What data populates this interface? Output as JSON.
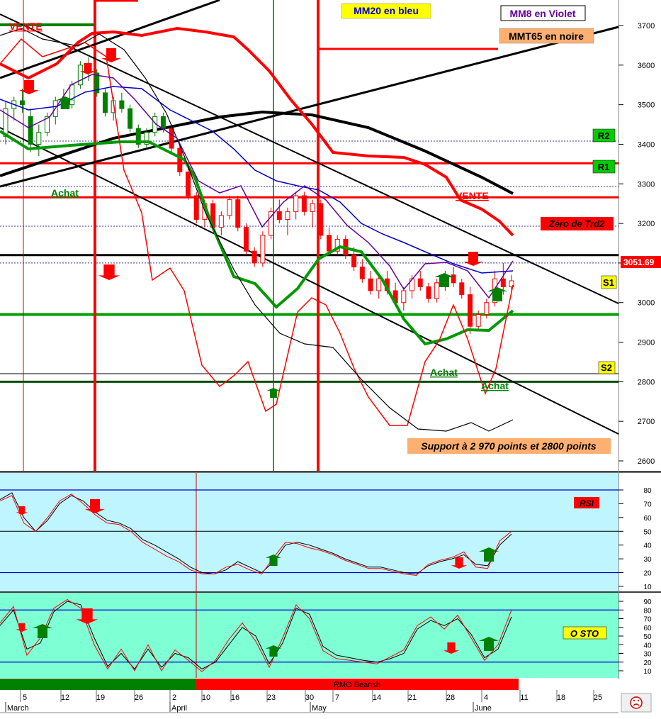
{
  "chart_data": [
    {
      "type": "candlestick",
      "panel": "price",
      "ylim": [
        2580,
        3760
      ],
      "y_ticks": [
        "3700",
        "3600",
        "3500",
        "3400",
        "3300",
        "3200",
        "3100",
        "3000",
        "2900",
        "2800",
        "2700",
        "2600"
      ],
      "last_price_label": "3051.69",
      "annotations": {
        "mm20": "MM20 en bleu",
        "mm8": "MM8 en Violet",
        "mmt65": "MMT65 en noire",
        "vente_top": "VENTE",
        "vente_right": "VENTE",
        "achat_left": "Achat",
        "achat_mid": "Achat",
        "achat_right": "Achat",
        "zero_trd2": "Zéro de Trd2",
        "support": "Support à 2 970 points et 2800 points",
        "r2": "R2",
        "r1": "R1",
        "s1": "S1",
        "s2": "S2"
      },
      "levels": {
        "R2": 3352,
        "R1": 3266,
        "zero_trd2": 3120,
        "S1": 2970,
        "S2": 2800,
        "top_green": 3700
      },
      "candles": [
        [
          3420,
          3510,
          3400,
          3490
        ],
        [
          3490,
          3520,
          3460,
          3510
        ],
        [
          3510,
          3540,
          3480,
          3500
        ],
        [
          3470,
          3490,
          3380,
          3400
        ],
        [
          3400,
          3450,
          3370,
          3430
        ],
        [
          3430,
          3480,
          3420,
          3470
        ],
        [
          3470,
          3520,
          3450,
          3510
        ],
        [
          3510,
          3540,
          3490,
          3500
        ],
        [
          3500,
          3560,
          3490,
          3550
        ],
        [
          3550,
          3610,
          3540,
          3600
        ],
        [
          3600,
          3620,
          3560,
          3580
        ],
        [
          3580,
          3590,
          3520,
          3530
        ],
        [
          3530,
          3540,
          3470,
          3480
        ],
        [
          3480,
          3520,
          3460,
          3510
        ],
        [
          3510,
          3530,
          3480,
          3490
        ],
        [
          3490,
          3500,
          3430,
          3440
        ],
        [
          3440,
          3450,
          3390,
          3400
        ],
        [
          3400,
          3440,
          3390,
          3430
        ],
        [
          3430,
          3480,
          3420,
          3470
        ],
        [
          3470,
          3480,
          3430,
          3440
        ],
        [
          3440,
          3450,
          3380,
          3390
        ],
        [
          3390,
          3400,
          3320,
          3330
        ],
        [
          3330,
          3340,
          3260,
          3270
        ],
        [
          3270,
          3280,
          3200,
          3210
        ],
        [
          3210,
          3260,
          3190,
          3250
        ],
        [
          3250,
          3260,
          3180,
          3190
        ],
        [
          3190,
          3230,
          3170,
          3220
        ],
        [
          3220,
          3270,
          3210,
          3260
        ],
        [
          3260,
          3270,
          3180,
          3190
        ],
        [
          3190,
          3200,
          3120,
          3130
        ],
        [
          3130,
          3140,
          3090,
          3100
        ],
        [
          3100,
          3180,
          3090,
          3170
        ],
        [
          3170,
          3240,
          3160,
          3230
        ],
        [
          3230,
          3260,
          3200,
          3210
        ],
        [
          3210,
          3240,
          3170,
          3230
        ],
        [
          3230,
          3280,
          3210,
          3270
        ],
        [
          3270,
          3280,
          3220,
          3230
        ],
        [
          3230,
          3260,
          3190,
          3250
        ],
        [
          3250,
          3260,
          3160,
          3170
        ],
        [
          3170,
          3190,
          3120,
          3130
        ],
        [
          3130,
          3170,
          3120,
          3160
        ],
        [
          3160,
          3170,
          3110,
          3120
        ],
        [
          3120,
          3140,
          3080,
          3090
        ],
        [
          3090,
          3110,
          3050,
          3060
        ],
        [
          3060,
          3080,
          3020,
          3030
        ],
        [
          3030,
          3070,
          3010,
          3060
        ],
        [
          3060,
          3080,
          3020,
          3030
        ],
        [
          3030,
          3050,
          2990,
          3000
        ],
        [
          3000,
          3040,
          2980,
          3030
        ],
        [
          3030,
          3070,
          3010,
          3060
        ],
        [
          3060,
          3080,
          3030,
          3040
        ],
        [
          3040,
          3050,
          3000,
          3010
        ],
        [
          3010,
          3060,
          3000,
          3050
        ],
        [
          3050,
          3080,
          3030,
          3070
        ],
        [
          3070,
          3090,
          3040,
          3050
        ],
        [
          3050,
          3060,
          3010,
          3020
        ],
        [
          3020,
          3040,
          2920,
          2940
        ],
        [
          2940,
          2980,
          2930,
          2970
        ],
        [
          2970,
          3010,
          2960,
          3000
        ],
        [
          3000,
          3080,
          2990,
          3060
        ],
        [
          3060,
          3100,
          3020,
          3040
        ],
        [
          3040,
          3070,
          3030,
          3055
        ]
      ]
    },
    {
      "type": "line",
      "panel": "rsi",
      "title": "RSI",
      "ylim": [
        5,
        88
      ],
      "y_ticks": [
        "80",
        "70",
        "60",
        "50",
        "40",
        "30",
        "20",
        "10"
      ],
      "levels": [
        80,
        50,
        20
      ],
      "series": [
        {
          "color": "#000000",
          "values": [
            73,
            78,
            60,
            50,
            58,
            70,
            76,
            72,
            64,
            58,
            56,
            52,
            44,
            40,
            35,
            30,
            24,
            20,
            19,
            22,
            28,
            24,
            20,
            28,
            40,
            42,
            40,
            37,
            34,
            30,
            27,
            24,
            24,
            22,
            20,
            19,
            25,
            28,
            30,
            33,
            26,
            25,
            40,
            48
          ]
        },
        {
          "color": "#ff0000",
          "values": [
            72,
            76,
            56,
            50,
            60,
            72,
            77,
            70,
            62,
            56,
            55,
            50,
            42,
            37,
            32,
            28,
            22,
            19,
            19,
            24,
            26,
            22,
            19,
            31,
            42,
            41,
            38,
            36,
            33,
            29,
            26,
            23,
            23,
            21,
            19,
            18,
            26,
            29,
            31,
            35,
            24,
            23,
            43,
            50
          ]
        }
      ]
    },
    {
      "type": "line",
      "panel": "stochastic",
      "title": "O STO",
      "ylim": [
        2,
        98
      ],
      "y_ticks": [
        "90",
        "80",
        "70",
        "60",
        "50",
        "40",
        "30",
        "20",
        "10"
      ],
      "levels": [
        80,
        20
      ],
      "series": [
        {
          "color": "#000000",
          "values": [
            62,
            80,
            35,
            42,
            78,
            90,
            86,
            48,
            15,
            30,
            12,
            35,
            14,
            30,
            25,
            12,
            20,
            40,
            60,
            50,
            18,
            42,
            82,
            75,
            38,
            28,
            25,
            22,
            20,
            24,
            30,
            58,
            68,
            62,
            70,
            52,
            25,
            35,
            72
          ]
        },
        {
          "color": "#ff0000",
          "values": [
            65,
            84,
            28,
            48,
            82,
            92,
            82,
            40,
            12,
            35,
            10,
            40,
            10,
            34,
            22,
            9,
            22,
            46,
            65,
            44,
            14,
            48,
            86,
            70,
            33,
            24,
            22,
            20,
            18,
            26,
            34,
            62,
            72,
            58,
            74,
            48,
            22,
            40,
            80
          ]
        }
      ]
    },
    {
      "type": "axis",
      "panel": "time",
      "x_ticks": [
        "5",
        "12",
        "19",
        "26",
        "2",
        "10",
        "16",
        "23",
        "30",
        "7",
        "14",
        "21",
        "28",
        "4",
        "11",
        "18",
        "25"
      ],
      "months": [
        "March",
        "April",
        "May",
        "June"
      ],
      "rmo_label": "RMO Bearish"
    }
  ],
  "colors": {
    "red": "#ff0000",
    "green": "#008000",
    "blue": "#0000cc",
    "violet": "#660099",
    "rsi_bg": "#bff5ff",
    "sto_bg": "#7fffd4",
    "yellow_box": "#ffff00",
    "orange_box": "#ffb070"
  },
  "icons": {
    "status": "sad-face-icon"
  }
}
